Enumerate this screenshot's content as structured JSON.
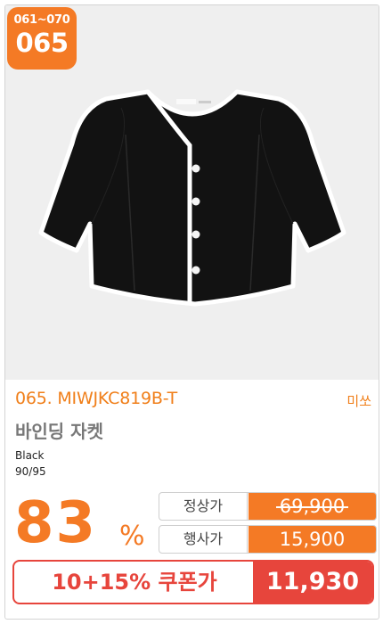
{
  "badge": {
    "range": "061~070",
    "number": "065"
  },
  "product": {
    "code": "065. MIWJKC819B-T",
    "brand": "미쏘",
    "name": "바인딩 자켓",
    "color": "Black",
    "size": "90/95"
  },
  "discount": {
    "value": "83",
    "unit": "%"
  },
  "prices": {
    "regular_label": "정상가",
    "regular_value": "69,900",
    "event_label": "행사가",
    "event_value": "15,900"
  },
  "coupon": {
    "label": "10+15% 쿠폰가",
    "value": "11,930"
  },
  "colors": {
    "accent": "#f47a25",
    "coupon": "#e7453c"
  }
}
